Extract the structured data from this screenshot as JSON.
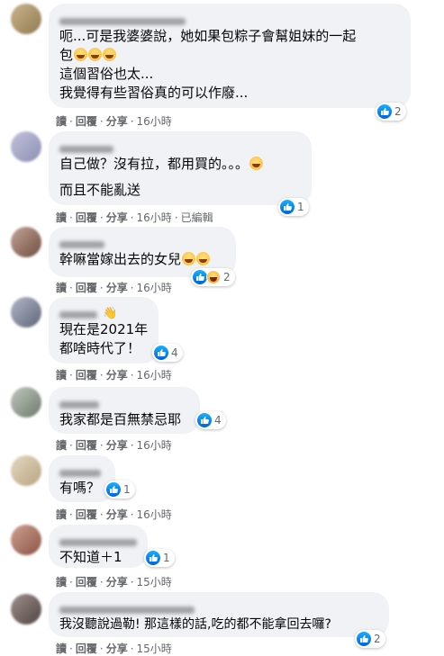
{
  "ui": {
    "action_read": "讀",
    "action_reply": "回覆",
    "action_share": "分享",
    "separator": "·",
    "hand_emoji": "👋"
  },
  "comments": [
    {
      "lines": [
        "呃...可是我婆婆說，她如果包粽子會幫姐妹的一起",
        "包",
        "這個習俗也太...",
        "我覺得有些習俗真的可以作廢..."
      ],
      "reaction_count": "2",
      "time": "16小時",
      "avatar_color": "#b9a27a"
    },
    {
      "lines": [
        "自己做？沒有拉，都用買的。。。",
        "而且不能亂送"
      ],
      "reaction_count": "1",
      "time": "16小時",
      "edited": "已編輯",
      "avatar_color": "#a7a8c4"
    },
    {
      "lines": [
        "幹嘛當嫁出去的女兒"
      ],
      "reaction_count": "2",
      "time": "16小時",
      "avatar_color": "#9b7a6d"
    },
    {
      "lines": [
        "現在是2021年",
        "都啥時代了！"
      ],
      "reaction_count": "4",
      "time": "16小時",
      "avatar_color": "#8c93a8"
    },
    {
      "lines": [
        "我家都是百無禁忌耶"
      ],
      "reaction_count": "4",
      "time": "16小時",
      "avatar_color": "#8f9a8a"
    },
    {
      "lines": [
        "有嗎？"
      ],
      "reaction_count": "1",
      "time": "16小時",
      "avatar_color": "#d3c4a8"
    },
    {
      "lines": [
        "不知道＋1"
      ],
      "reaction_count": "1",
      "time": "15小時",
      "avatar_color": "#b57e6b"
    },
    {
      "lines": [
        "我沒聽說過勒! 那這樣的話,吃的都不能拿回去囉?"
      ],
      "reaction_count": "2",
      "time": "15小時",
      "avatar_color": "#7b6d6a"
    }
  ],
  "colors": {
    "bubble": "#f0f2f5",
    "like_blue": "#1877f2",
    "meta_gray": "#65676b"
  }
}
